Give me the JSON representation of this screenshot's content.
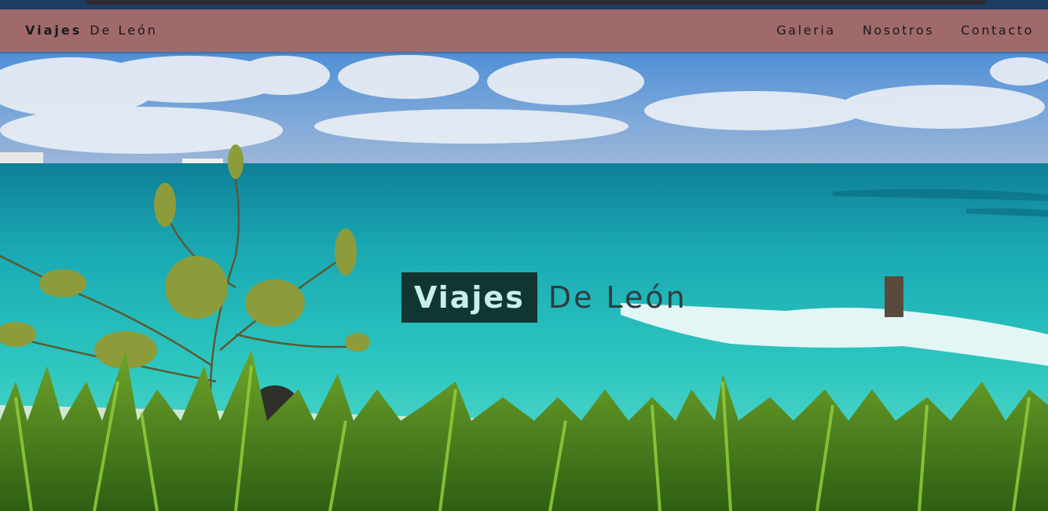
{
  "navbar": {
    "brand_bold": "Viajes",
    "brand_rest": "De León",
    "links": [
      "Galeria",
      "Nosotros",
      "Contacto"
    ]
  },
  "hero": {
    "title_bold": "Viajes",
    "title_rest": "De León"
  }
}
